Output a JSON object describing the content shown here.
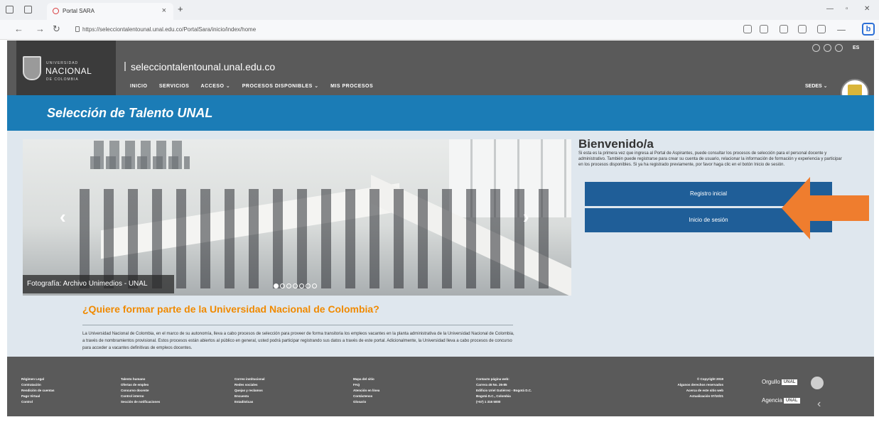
{
  "browser": {
    "tab_title": "Portal SARA",
    "tab_close": "×",
    "new_tab": "+",
    "url": "https://selecciontalentounal.unal.edu.co/PortalSara/inicio/index/home"
  },
  "logo": {
    "small_top": "UNIVERSIDAD",
    "big": "NACIONAL",
    "small_bottom": "DE COLOMBIA"
  },
  "header": {
    "domain": "selecciontalentounal.unal.edu.co",
    "menu": [
      "INICIO",
      "SERVICIOS",
      "ACCESO ⌄",
      "PROCESOS DISPONIBLES ⌄",
      "MIS PROCESOS"
    ],
    "sedes": "SEDES ⌄",
    "lang": "ES"
  },
  "page_title": "Selección de Talento UNAL",
  "carousel": {
    "caption": "Fotografía: Archivo Unimedios - UNAL",
    "prev": "‹",
    "next": "›"
  },
  "welcome": {
    "title": "Bienvenido/a",
    "text": "Si esta es la primera vez que ingresa al Portal de Aspirantes, puede consultar los procesos de selección para el personal docente y administrativo. También puede registrarse para crear su cuenta de usuario, relacionar la información de formación y experiencia y participar en los procesos disponibles. Si ya ha registrado previamente, por favor haga clic en el botón Inicio de sesión.",
    "register_button": "Registro inicial",
    "login_button": "Inicio de sesión"
  },
  "question": "¿Quiere formar parte de la Universidad Nacional de Colombia?",
  "paragraph": "La Universidad Nacional de Colombia, en el marco de su autonomía, lleva a cabo procesos de selección para proveer de forma transitoria los empleos vacantes en la planta administrativa de la Universidad Nacional de Colombia, a través de nombramientos provisional. Estos procesos están abiertos al público en general, usted podrá participar registrando sus datos a través de este portal. Adicionalmente, la Universidad lleva a cabo procesos de concurso para acceder a vacantes definitivas de empleos docentes.",
  "footer": {
    "col1": [
      "Régimen Legal",
      "Contratación",
      "Rendición de cuentas",
      "Pago Virtual",
      "Control"
    ],
    "col2": [
      "Talento humano",
      "Ofertas de empleo",
      "Concurso docente",
      "Control interno",
      "Sección de notificaciones"
    ],
    "col3": [
      "Correo institucional",
      "Redes sociales",
      "Quejas y reclamos",
      "Encuesta",
      "Estadísticas"
    ],
    "col4": [
      "Mapa del sitio",
      "FAQ",
      "Atención en línea",
      "Contáctenos",
      "Glosario"
    ],
    "col5": [
      "Contacto página web:",
      "Carrera 45 No. 26-85",
      "Edificio Uriel Gutiérrez - Bogotá D.C.",
      "Bogotá D.C., Colombia",
      "(+57) 1 316 5000"
    ],
    "col6": [
      "© Copyright 2019",
      "Algunos derechos reservados",
      "Acerca de este sitio web",
      "Actualización 07/10/21"
    ],
    "orgullo": "Orgullo",
    "agencia": "Agencia",
    "badge": "UNAL"
  }
}
